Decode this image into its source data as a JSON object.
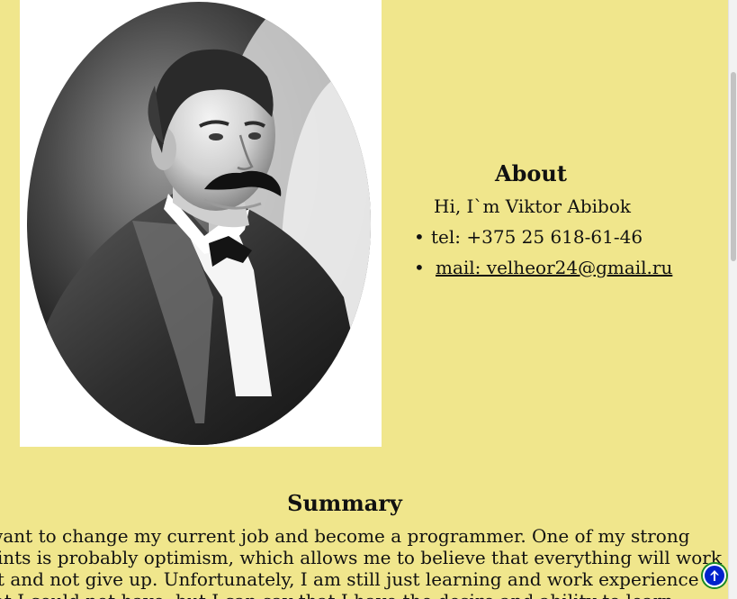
{
  "about": {
    "title": "About",
    "intro": "Hi, I`m Viktor Abibok",
    "tel": "tel: +375 25 618-61-46",
    "mail": "mail: velheor24@gmail.ru",
    "bullet": "•"
  },
  "summary": {
    "title": "Summary",
    "lines": [
      "I want to change my current job and become a programmer. One of my strong",
      "points is probably optimism, which allows me to believe that everything will work",
      "out and not give up. Unfortunately, I am still just learning and work experience",
      "that I could not have, but I can say that I have the desire and ability to learn"
    ]
  },
  "icons": {
    "portrait": "portrait-photo",
    "back_to_top": "arrow-up-circle-icon"
  },
  "colors": {
    "background": "#f0e68c",
    "button_outer": "#1a8a23",
    "button_inner": "#0022cc"
  }
}
